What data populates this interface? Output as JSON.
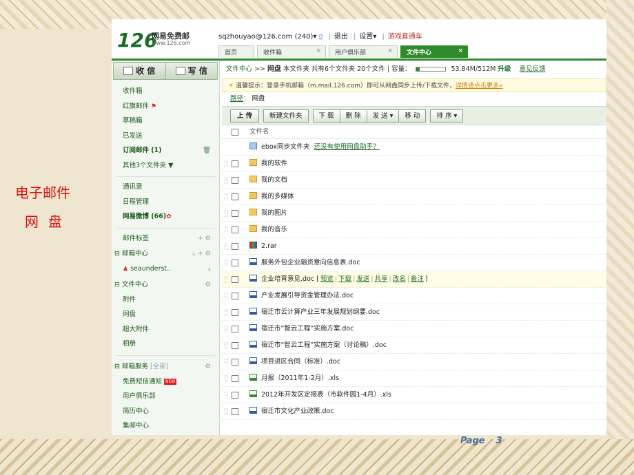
{
  "slide": {
    "caption_line1": "电子邮件",
    "caption_line2": "网盘",
    "page_label": "Page",
    "page_number": "3"
  },
  "header": {
    "logo": "126",
    "brand": "网易免费邮",
    "brand_url": "www.126.com",
    "account": "sqzhouyao@126.com (240)",
    "logout": "退出",
    "settings": "设置",
    "game": "游戏直通车",
    "tabs": [
      "首页",
      "收件箱",
      "用户俱乐部",
      "文件中心"
    ]
  },
  "sidebar": {
    "receive": "收 信",
    "write": "写 信",
    "folders": [
      "收件箱",
      "红旗邮件",
      "草稿箱",
      "已发送",
      "订阅邮件 (1)",
      "其他3个文件夹"
    ],
    "tools": [
      "通讯录",
      "日程管理",
      "网易微博 (66)"
    ],
    "mail_tags": "邮件标签",
    "mail_center": "邮箱中心",
    "account_short": "seaunderst..",
    "file_center": "文件中心",
    "file_items": [
      "附件",
      "网盘",
      "超大附件",
      "相册"
    ],
    "mail_service": "邮箱服务",
    "mail_service_all": "[全部]",
    "services": [
      "免费短信通知",
      "用户俱乐部",
      "简历中心",
      "集邮中心"
    ],
    "new_badge": "NEW"
  },
  "main": {
    "crumb_file_center": "文件中心",
    "crumb_arrow": ">>",
    "crumb_disk": "网盘",
    "crumb_stats": "本文件夹 共有6个文件夹 20个文件 | 容量：",
    "capacity": "53.84M/512M",
    "capacity_fraction": 0.105,
    "upgrade": "升级",
    "feedback": "意见反馈",
    "tip_text": "温馨提示：登录手机邮箱（m.mail.126.com）即可从网盘同步上传/下载文件，",
    "tip_link": "详情请点击更多»",
    "path_label": "路径",
    "path_value": "网盘",
    "toolbar": [
      "上 传",
      "新建文件夹",
      "下 载",
      "删 除",
      "发 送 ▾",
      "移 动",
      "排 序 ▾"
    ],
    "col_name": "文件名",
    "ebox_name": "ebox同步文件夹",
    "ebox_link": "还没有使用网盘助手？",
    "folders": [
      "我的软件",
      "我的文档",
      "我的多媒体",
      "我的图片",
      "我的音乐"
    ],
    "files": [
      {
        "name": "2.rar",
        "type": "rar"
      },
      {
        "name": "服务外包企业融资意向信息表.doc",
        "type": "doc"
      },
      {
        "name": "企业培育意见.doc",
        "type": "doc"
      },
      {
        "name": "产业发展引导资金管理办法.doc",
        "type": "doc"
      },
      {
        "name": "宿迁市云计算产业三年发展规划纲要.doc",
        "type": "doc"
      },
      {
        "name": "宿迁市“智云工程”实施方案.doc",
        "type": "doc"
      },
      {
        "name": "宿迁市“智云工程”实施方案（讨论稿）.doc",
        "type": "doc"
      },
      {
        "name": "项目进区合同（标准）.doc",
        "type": "doc"
      },
      {
        "name": "月报（2011年1-2月）.xls",
        "type": "xls"
      },
      {
        "name": "2012年开发区定报表（市软件园1-4月）.xls",
        "type": "xls"
      },
      {
        "name": "宿迁市文化产业政策.doc",
        "type": "doc"
      }
    ],
    "row_actions": [
      "预览",
      "下载",
      "发送",
      "共享",
      "改名",
      "备注"
    ]
  }
}
